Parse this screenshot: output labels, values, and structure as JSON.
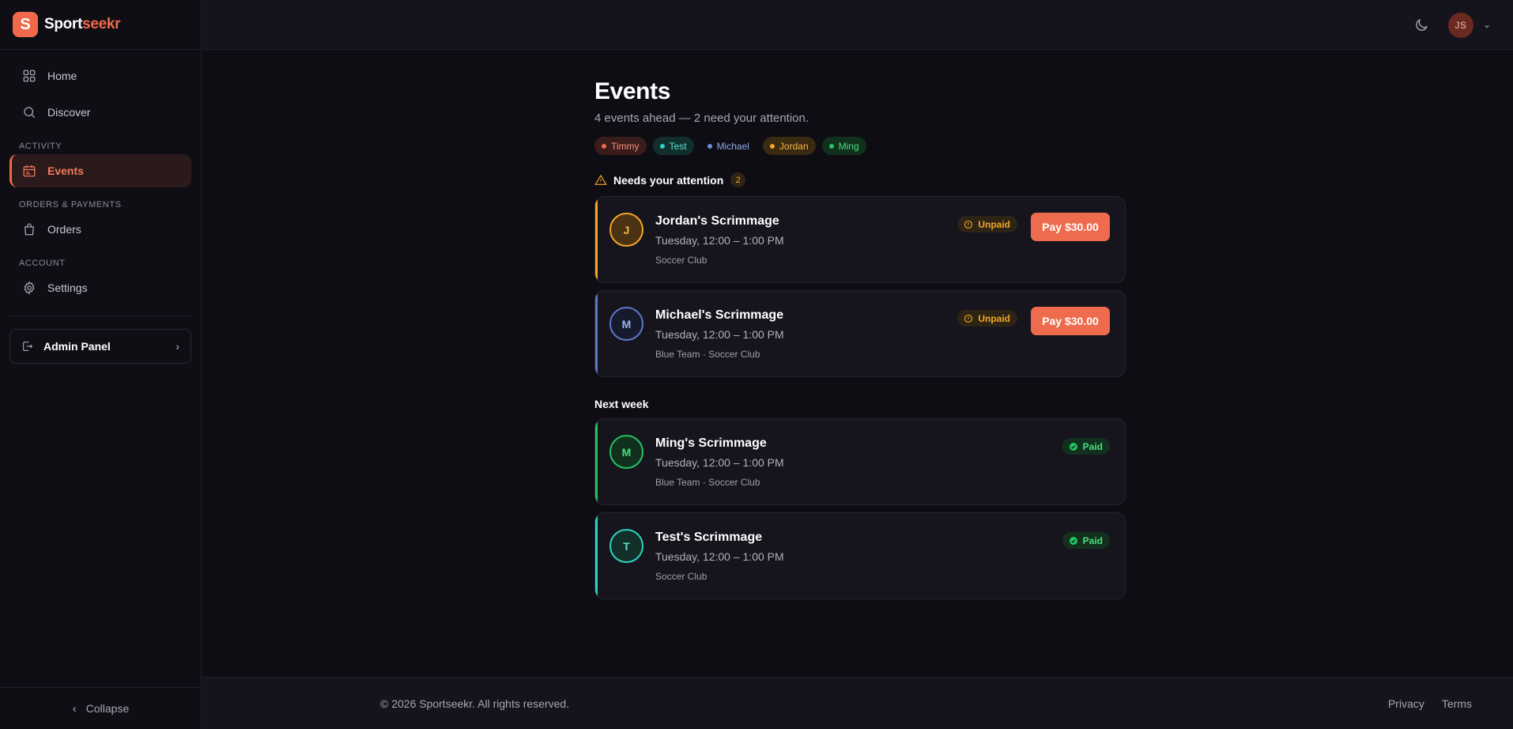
{
  "brand": {
    "part1": "Sport",
    "part2": "seekr",
    "logo_letter": "S",
    "accent": "#f0694a"
  },
  "sidebar": {
    "items_top": [
      {
        "label": "Home",
        "icon": "grid-icon"
      },
      {
        "label": "Discover",
        "icon": "search-icon"
      }
    ],
    "sections": [
      {
        "label": "ACTIVITY",
        "items": [
          {
            "label": "Events",
            "icon": "calendar-icon",
            "active": true
          }
        ]
      },
      {
        "label": "ORDERS & PAYMENTS",
        "items": [
          {
            "label": "Orders",
            "icon": "bag-icon"
          }
        ]
      },
      {
        "label": "ACCOUNT",
        "items": [
          {
            "label": "Settings",
            "icon": "gear-icon"
          }
        ]
      }
    ],
    "admin_label": "Admin Panel",
    "collapse_label": "Collapse"
  },
  "topbar": {
    "user_initials": "JS"
  },
  "page": {
    "title": "Events",
    "subtitle": "4 events ahead — 2 need your attention.",
    "filters": [
      {
        "label": "Timmy",
        "color": "#f0694a",
        "bg": "#3a1d1a",
        "text": "#f58f78"
      },
      {
        "label": "Test",
        "color": "#2dd4bf",
        "bg": "#11302d",
        "text": "#5ee0cf"
      },
      {
        "label": "Michael",
        "color": "#6f8fdc",
        "bg": "transparent",
        "text": "#8ea8ec"
      },
      {
        "label": "Jordan",
        "color": "#f5a623",
        "bg": "#3a2a12",
        "text": "#f5b443"
      },
      {
        "label": "Ming",
        "color": "#22c55e",
        "bg": "#11301d",
        "text": "#4ade80"
      }
    ]
  },
  "attention": {
    "heading": "Needs your attention",
    "count": "2",
    "events": [
      {
        "initial": "J",
        "title": "Jordan's Scrimmage",
        "time": "Tuesday, 12:00 – 1:00 PM",
        "team": "Soccer Club",
        "status": "Unpaid",
        "pay_label": "Pay $30.00",
        "accent": "#f5a623",
        "avatar_bg": "#4a3212",
        "avatar_text": "#f5b443"
      },
      {
        "initial": "M",
        "title": "Michael's Scrimmage",
        "time": "Tuesday, 12:00 – 1:00 PM",
        "team": "Blue Team · Soccer Club",
        "status": "Unpaid",
        "pay_label": "Pay $30.00",
        "accent": "#5a78c8",
        "avatar_bg": "#161a2c",
        "avatar_text": "#9db1ee"
      }
    ]
  },
  "next_week": {
    "heading": "Next week",
    "events": [
      {
        "initial": "M",
        "title": "Ming's Scrimmage",
        "time": "Tuesday, 12:00 – 1:00 PM",
        "team": "Blue Team · Soccer Club",
        "status": "Paid",
        "accent": "#22c55e",
        "avatar_bg": "#12301e",
        "avatar_text": "#4ade80"
      },
      {
        "initial": "T",
        "title": "Test's Scrimmage",
        "time": "Tuesday, 12:00 – 1:00 PM",
        "team": "Soccer Club",
        "status": "Paid",
        "accent": "#2dd4bf",
        "avatar_bg": "#123029",
        "avatar_text": "#5ee0cf"
      }
    ]
  },
  "footer": {
    "copyright": "© 2026 Sportseekr. All rights reserved.",
    "links": [
      "Privacy",
      "Terms"
    ]
  }
}
